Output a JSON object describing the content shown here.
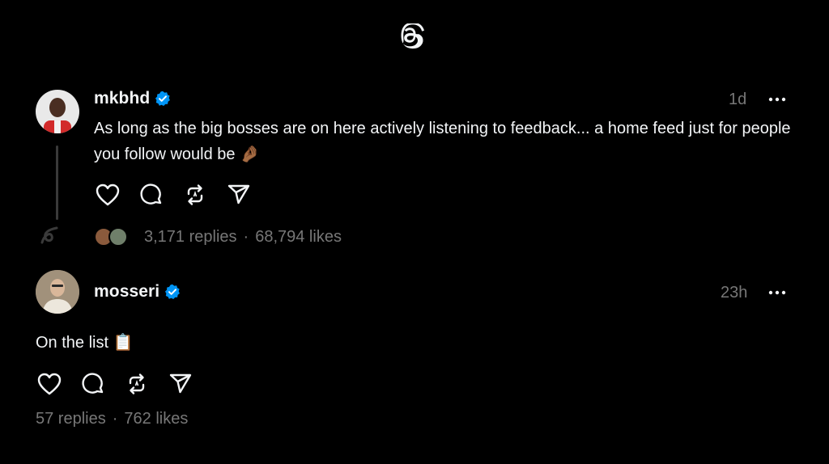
{
  "header": {
    "logo_icon": "threads-logo-icon"
  },
  "posts": [
    {
      "username": "mkbhd",
      "verified": true,
      "time": "1d",
      "text": "As long as the big bosses are on here actively listening to feedback... a home feed just for people you follow would be 🤌🏾",
      "replies": "3,171 replies",
      "likes": "68,794 likes",
      "separator": "·"
    },
    {
      "username": "mosseri",
      "verified": true,
      "time": "23h",
      "text": "On the list 📋",
      "replies": "57 replies",
      "likes": "762 likes",
      "separator": "·"
    }
  ],
  "colors": {
    "background": "#000000",
    "text": "#f3f5f7",
    "muted": "#777777",
    "verified": "#0095f6"
  },
  "action_icons": [
    "heart-icon",
    "comment-icon",
    "repost-icon",
    "share-icon"
  ]
}
